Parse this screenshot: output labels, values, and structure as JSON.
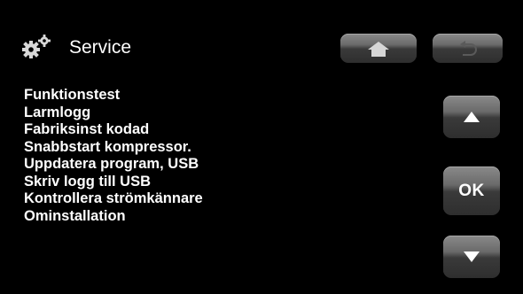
{
  "header": {
    "title": "Service",
    "icon": "gears-icon"
  },
  "menu": {
    "items": [
      {
        "label": "Funktionstest"
      },
      {
        "label": "Larmlogg"
      },
      {
        "label": "Fabriksinst kodad"
      },
      {
        "label": "Snabbstart kompressor."
      },
      {
        "label": "Uppdatera program, USB"
      },
      {
        "label": "Skriv logg till USB"
      },
      {
        "label": "Kontrollera strömkännare"
      },
      {
        "label": "Ominstallation"
      }
    ]
  },
  "nav": {
    "home_icon": "home-icon",
    "back_icon": "back-arrow-icon",
    "up_icon": "up-arrow-icon",
    "ok_label": "OK",
    "down_icon": "down-arrow-icon"
  },
  "colors": {
    "background": "#000000",
    "text": "#ffffff",
    "button": "#5a5a5a"
  }
}
